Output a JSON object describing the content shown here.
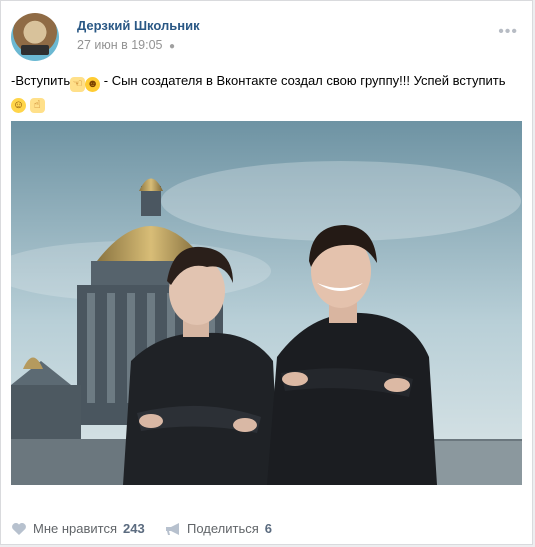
{
  "post": {
    "author": "Дерзкий Школьник",
    "date": "27 июн в 19:05",
    "platform_icon": "apple-icon",
    "text_parts": {
      "part1": "-Вступить",
      "part2": " - Сын создателя в Вконтакте создал свою группу!!! Успей вступить"
    },
    "photo_alt": "Two men in dark jackets standing with arms crossed in front of a domed cathedral"
  },
  "actions": {
    "like_label": "Мне нравится",
    "like_count": "243",
    "share_label": "Поделиться",
    "share_count": "6"
  },
  "colors": {
    "author": "#2a5885",
    "muted": "#939393",
    "accent": "#5b6b7f"
  }
}
